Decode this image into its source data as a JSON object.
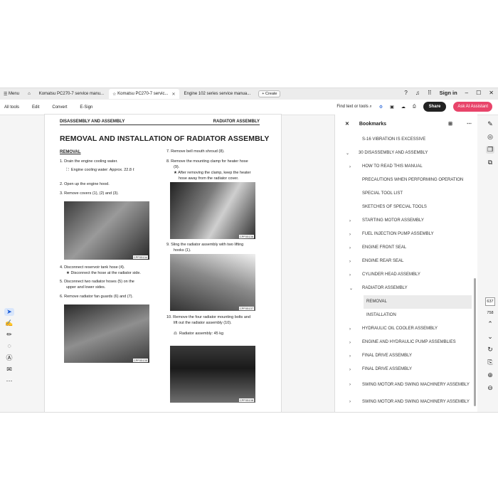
{
  "tabs": [
    {
      "label": "Menu",
      "icon": "menu-icon"
    },
    {
      "label": "home",
      "icon": "home-icon"
    },
    {
      "label": "Komatsu PC270-7 service manu..."
    },
    {
      "label": "Komatsu PC270-7 servic..."
    },
    {
      "label": "Engine 102 series service manua..."
    }
  ],
  "create_label": "+ Create",
  "window": {
    "signin": "Sign in"
  },
  "toolbar": {
    "items": [
      "All tools",
      "Edit",
      "Convert",
      "E-Sign"
    ],
    "find": "Find text or tools",
    "share": "Share",
    "ai": "Ask AI Assistant"
  },
  "pdf": {
    "header_left": "DISASSEMBLY AND ASSEMBLY",
    "header_right": "RADIATOR ASSEMBLY",
    "title": "REMOVAL AND INSTALLATION OF RADIATOR ASSEMBLY",
    "subtitle": "REMOVAL",
    "steps_left": [
      "1.   Drain the engine cooling water.",
      "Engine cooling water:   Approx. 22.8 ℓ",
      "2.   Open up the engine hood.",
      "3.   Remove covers (1), (2) and (3).",
      "4.   Disconnect reservoir tank hose (4).",
      "★  Disconnect the hose at the radiator side.",
      "5.   Disconnect two radiator hoses (5) on the",
      "upper and lower sides.",
      "6.   Remove radiator fan guards (6) and (7)."
    ],
    "steps_right": [
      "7.   Remove bell mouth shroud (8).",
      "8.   Remove the mounting clamp for heater hose",
      "(9).",
      "★  After removing the clamp, keep the heater",
      "hose away from the radiator cover.",
      "9.   Sling the radiator assembly with two lifting",
      "hooks (1).",
      "10.  Remove the four radiator mounting bolts and",
      "lift out the radiator assembly (10).",
      "Radiator assembly:   45 kg"
    ],
    "captions": [
      "CPF05134",
      "CPF05135",
      "CPF05136",
      "CPF05137",
      "CPF05138"
    ]
  },
  "bookmarks": {
    "title": "Bookmarks",
    "items": [
      {
        "label": "S-16 VIBRATION IS EXCESSIVE",
        "level": 2,
        "chev": ""
      },
      {
        "label": "30 DISASSEMBLY AND ASSEMBLY",
        "level": 1,
        "chev": "v"
      },
      {
        "label": "HOW TO READ THIS MANUAL",
        "level": 2,
        "chev": ">"
      },
      {
        "label": "PRECAUTIONS WHEN PERFORMING OPERATION",
        "level": 2,
        "chev": ""
      },
      {
        "label": "SPECIAL TOOL LIST",
        "level": 2,
        "chev": ""
      },
      {
        "label": "SKETCHES OF SPECIAL TOOLS",
        "level": 2,
        "chev": ""
      },
      {
        "label": "STARTING MOTOR ASSEMBLY",
        "level": 2,
        "chev": ">"
      },
      {
        "label": "FUEL INJECTION PUMP ASSEMBLY",
        "level": 2,
        "chev": ">"
      },
      {
        "label": "ENGINE FRONT SEAL",
        "level": 2,
        "chev": ">"
      },
      {
        "label": "ENGINE REAR SEAL",
        "level": 2,
        "chev": ">"
      },
      {
        "label": "CYLINDER HEAD ASSEMBLY",
        "level": 2,
        "chev": ">"
      },
      {
        "label": "RADIATOR ASSEMBLY",
        "level": 2,
        "chev": "v"
      },
      {
        "label": "REMOVAL",
        "level": 3,
        "chev": "",
        "selected": true
      },
      {
        "label": "INSTALLATION",
        "level": 3,
        "chev": ""
      },
      {
        "label": "HYDRAULIC OIL COOLER ASSEMBLY",
        "level": 2,
        "chev": ">"
      },
      {
        "label": "ENGINE AND HYDRAULIC PUMP ASSEMBLIES",
        "level": 2,
        "chev": ">"
      },
      {
        "label": "FINAL DRIVE ASSEMBLY",
        "level": 2,
        "chev": ">"
      },
      {
        "label": "FINAL DRIVE ASSEMBLY",
        "level": 2,
        "chev": ">"
      },
      {
        "label": "SWING MOTOR AND SWING MACHINERY ASSEMBLY",
        "level": 2,
        "chev": ">"
      },
      {
        "label": "SWING MOTOR AND SWING MACHINERY ASSEMBLY",
        "level": 2,
        "chev": ">"
      }
    ]
  },
  "page": {
    "current": "637",
    "total": "758"
  }
}
